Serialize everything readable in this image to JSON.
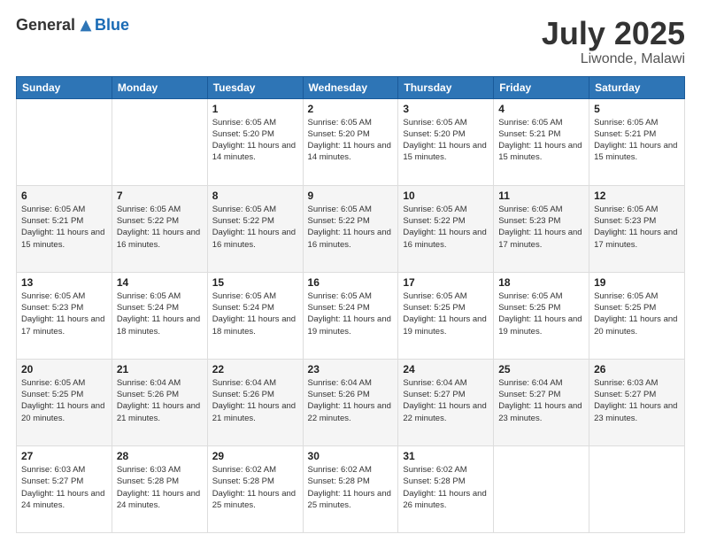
{
  "header": {
    "logo_general": "General",
    "logo_blue": "Blue",
    "month_year": "July 2025",
    "location": "Liwonde, Malawi"
  },
  "days_of_week": [
    "Sunday",
    "Monday",
    "Tuesday",
    "Wednesday",
    "Thursday",
    "Friday",
    "Saturday"
  ],
  "weeks": [
    [
      {
        "day": "",
        "info": ""
      },
      {
        "day": "",
        "info": ""
      },
      {
        "day": "1",
        "info": "Sunrise: 6:05 AM\nSunset: 5:20 PM\nDaylight: 11 hours and 14 minutes."
      },
      {
        "day": "2",
        "info": "Sunrise: 6:05 AM\nSunset: 5:20 PM\nDaylight: 11 hours and 14 minutes."
      },
      {
        "day": "3",
        "info": "Sunrise: 6:05 AM\nSunset: 5:20 PM\nDaylight: 11 hours and 15 minutes."
      },
      {
        "day": "4",
        "info": "Sunrise: 6:05 AM\nSunset: 5:21 PM\nDaylight: 11 hours and 15 minutes."
      },
      {
        "day": "5",
        "info": "Sunrise: 6:05 AM\nSunset: 5:21 PM\nDaylight: 11 hours and 15 minutes."
      }
    ],
    [
      {
        "day": "6",
        "info": "Sunrise: 6:05 AM\nSunset: 5:21 PM\nDaylight: 11 hours and 15 minutes."
      },
      {
        "day": "7",
        "info": "Sunrise: 6:05 AM\nSunset: 5:22 PM\nDaylight: 11 hours and 16 minutes."
      },
      {
        "day": "8",
        "info": "Sunrise: 6:05 AM\nSunset: 5:22 PM\nDaylight: 11 hours and 16 minutes."
      },
      {
        "day": "9",
        "info": "Sunrise: 6:05 AM\nSunset: 5:22 PM\nDaylight: 11 hours and 16 minutes."
      },
      {
        "day": "10",
        "info": "Sunrise: 6:05 AM\nSunset: 5:22 PM\nDaylight: 11 hours and 16 minutes."
      },
      {
        "day": "11",
        "info": "Sunrise: 6:05 AM\nSunset: 5:23 PM\nDaylight: 11 hours and 17 minutes."
      },
      {
        "day": "12",
        "info": "Sunrise: 6:05 AM\nSunset: 5:23 PM\nDaylight: 11 hours and 17 minutes."
      }
    ],
    [
      {
        "day": "13",
        "info": "Sunrise: 6:05 AM\nSunset: 5:23 PM\nDaylight: 11 hours and 17 minutes."
      },
      {
        "day": "14",
        "info": "Sunrise: 6:05 AM\nSunset: 5:24 PM\nDaylight: 11 hours and 18 minutes."
      },
      {
        "day": "15",
        "info": "Sunrise: 6:05 AM\nSunset: 5:24 PM\nDaylight: 11 hours and 18 minutes."
      },
      {
        "day": "16",
        "info": "Sunrise: 6:05 AM\nSunset: 5:24 PM\nDaylight: 11 hours and 19 minutes."
      },
      {
        "day": "17",
        "info": "Sunrise: 6:05 AM\nSunset: 5:25 PM\nDaylight: 11 hours and 19 minutes."
      },
      {
        "day": "18",
        "info": "Sunrise: 6:05 AM\nSunset: 5:25 PM\nDaylight: 11 hours and 19 minutes."
      },
      {
        "day": "19",
        "info": "Sunrise: 6:05 AM\nSunset: 5:25 PM\nDaylight: 11 hours and 20 minutes."
      }
    ],
    [
      {
        "day": "20",
        "info": "Sunrise: 6:05 AM\nSunset: 5:25 PM\nDaylight: 11 hours and 20 minutes."
      },
      {
        "day": "21",
        "info": "Sunrise: 6:04 AM\nSunset: 5:26 PM\nDaylight: 11 hours and 21 minutes."
      },
      {
        "day": "22",
        "info": "Sunrise: 6:04 AM\nSunset: 5:26 PM\nDaylight: 11 hours and 21 minutes."
      },
      {
        "day": "23",
        "info": "Sunrise: 6:04 AM\nSunset: 5:26 PM\nDaylight: 11 hours and 22 minutes."
      },
      {
        "day": "24",
        "info": "Sunrise: 6:04 AM\nSunset: 5:27 PM\nDaylight: 11 hours and 22 minutes."
      },
      {
        "day": "25",
        "info": "Sunrise: 6:04 AM\nSunset: 5:27 PM\nDaylight: 11 hours and 23 minutes."
      },
      {
        "day": "26",
        "info": "Sunrise: 6:03 AM\nSunset: 5:27 PM\nDaylight: 11 hours and 23 minutes."
      }
    ],
    [
      {
        "day": "27",
        "info": "Sunrise: 6:03 AM\nSunset: 5:27 PM\nDaylight: 11 hours and 24 minutes."
      },
      {
        "day": "28",
        "info": "Sunrise: 6:03 AM\nSunset: 5:28 PM\nDaylight: 11 hours and 24 minutes."
      },
      {
        "day": "29",
        "info": "Sunrise: 6:02 AM\nSunset: 5:28 PM\nDaylight: 11 hours and 25 minutes."
      },
      {
        "day": "30",
        "info": "Sunrise: 6:02 AM\nSunset: 5:28 PM\nDaylight: 11 hours and 25 minutes."
      },
      {
        "day": "31",
        "info": "Sunrise: 6:02 AM\nSunset: 5:28 PM\nDaylight: 11 hours and 26 minutes."
      },
      {
        "day": "",
        "info": ""
      },
      {
        "day": "",
        "info": ""
      }
    ]
  ]
}
